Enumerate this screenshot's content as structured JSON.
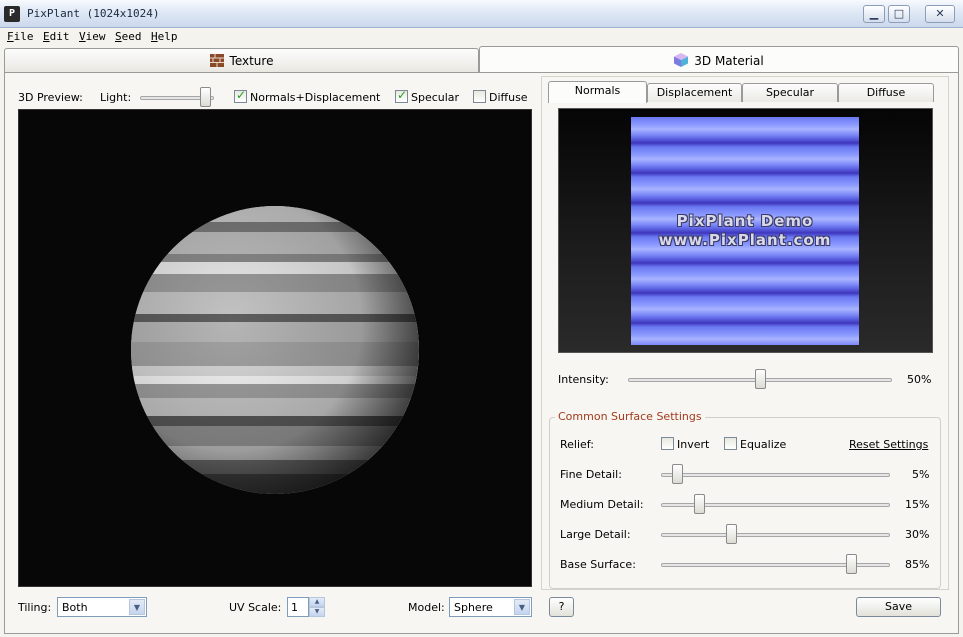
{
  "window": {
    "icon_text": "P",
    "title": "PixPlant  (1024x1024)",
    "minimize_glyph": "▁",
    "maximize_glyph": "□",
    "close_glyph": "✕"
  },
  "menu": [
    "File",
    "Edit",
    "View",
    "Seed",
    "Help"
  ],
  "main_tabs": [
    {
      "label": "Texture",
      "icon": "brick-icon"
    },
    {
      "label": "3D Material",
      "icon": "cube-icon"
    }
  ],
  "preview": {
    "label": "3D Preview:",
    "light_label": "Light:",
    "light_level": 0.95,
    "checkboxes": [
      {
        "label": "Normals+Displacement",
        "checked": true
      },
      {
        "label": "Specular",
        "checked": true
      },
      {
        "label": "Diffuse",
        "checked": false
      }
    ]
  },
  "bottom_bar": {
    "tiling_label": "Tiling:",
    "tiling_value": "Both",
    "uv_scale_label": "UV Scale:",
    "uv_scale_value": "1",
    "model_label": "Model:",
    "model_value": "Sphere"
  },
  "material_tabs": [
    "Normals",
    "Displacement",
    "Specular",
    "Diffuse"
  ],
  "normals": {
    "watermark_line1": "PixPlant Demo",
    "watermark_line2": "www.PixPlant.com",
    "intensity_label": "Intensity:",
    "intensity_value": "50%",
    "intensity_level": 0.5
  },
  "surface": {
    "group_title": "Common Surface Settings",
    "relief_label": "Relief:",
    "invert_label": "Invert",
    "equalize_label": "Equalize",
    "reset_label": "Reset Settings",
    "sliders": [
      {
        "label": "Fine Detail:",
        "value": "5%",
        "level": 0.05
      },
      {
        "label": "Medium Detail:",
        "value": "15%",
        "level": 0.15
      },
      {
        "label": "Large Detail:",
        "value": "30%",
        "level": 0.3
      },
      {
        "label": "Base Surface:",
        "value": "85%",
        "level": 0.85
      }
    ]
  },
  "footer": {
    "help_label": "?",
    "save_label": "Save"
  },
  "colors": {
    "accent_title": "#a13b1c",
    "normal_map_blue": "#7a87f7",
    "check_green": "#21a121"
  }
}
